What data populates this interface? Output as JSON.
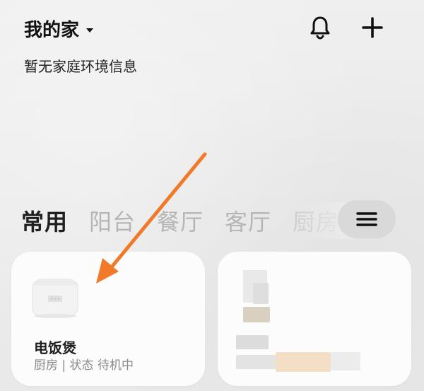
{
  "header": {
    "home_name": "我的家",
    "environment_info": "暂无家庭环境信息"
  },
  "room_tabs": [
    {
      "label": "常用",
      "active": true
    },
    {
      "label": "阳台",
      "active": false
    },
    {
      "label": "餐厅",
      "active": false
    },
    {
      "label": "客厅",
      "active": false
    },
    {
      "label": "厨房",
      "active": false
    }
  ],
  "devices": [
    {
      "name": "电饭煲",
      "status": "厨房 | 状态 待机中"
    }
  ],
  "colors": {
    "arrow": "#f07a2a",
    "card_bg": "#fcfcfc",
    "active_tab": "#1f1f1f",
    "inactive_tab": "#b5b5b5"
  },
  "icons": [
    "chevron-down-icon",
    "bell-icon",
    "plus-icon",
    "menu-icon",
    "rice-cooker-icon"
  ]
}
